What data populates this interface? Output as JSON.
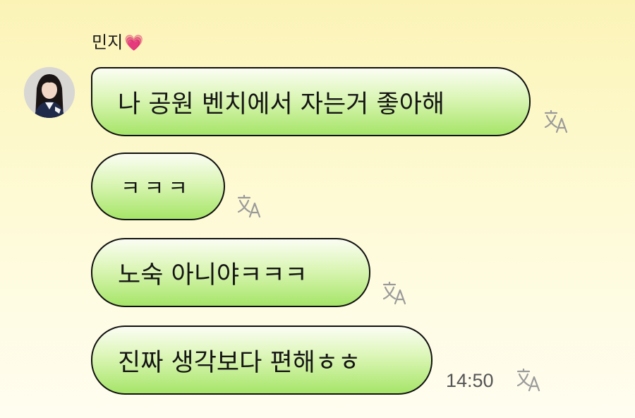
{
  "chat": {
    "sender_name": "민지",
    "sender_emoji": "💗",
    "messages": [
      {
        "text": "나 공원 벤치에서 자는거 좋아해"
      },
      {
        "text": "ㅋㅋㅋ"
      },
      {
        "text": "노숙 아니야ㅋㅋㅋ"
      },
      {
        "text": "진짜 생각보다 편해ㅎㅎ"
      }
    ],
    "timestamp": "14:50"
  },
  "icons": {
    "translate": "translate-icon",
    "avatar": "avatar"
  },
  "colors": {
    "background_top": "#fbf3b6",
    "background_bottom": "#fffdf0",
    "bubble_top": "#fbfdf3",
    "bubble_bottom": "#a6e568",
    "bubble_border": "#111111",
    "heart": "#e8539a",
    "timestamp": "#555555",
    "translate_icon": "#9a9a9a"
  }
}
